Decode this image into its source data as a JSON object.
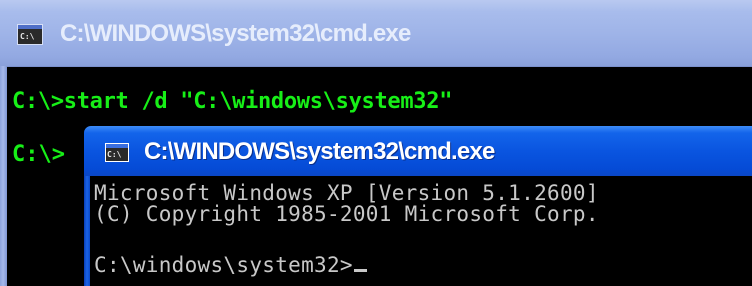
{
  "back_window": {
    "title": "C:\\WINDOWS\\system32\\cmd.exe",
    "icon": "console-icon",
    "lines": [
      "C:\\>start /d \"C:\\windows\\system32\"",
      "C:\\>"
    ],
    "text_color": "#17ef17",
    "title_bar_color": "#9fb4e8"
  },
  "front_window": {
    "title": "C:\\WINDOWS\\system32\\cmd.exe",
    "icon": "console-icon",
    "lines": [
      "Microsoft Windows XP [Version 5.1.2600]",
      "(C) Copyright 1985-2001 Microsoft Corp.",
      "C:\\windows\\system32>"
    ],
    "text_color": "#c8c8c8",
    "title_bar_color": "#0a55e0"
  }
}
